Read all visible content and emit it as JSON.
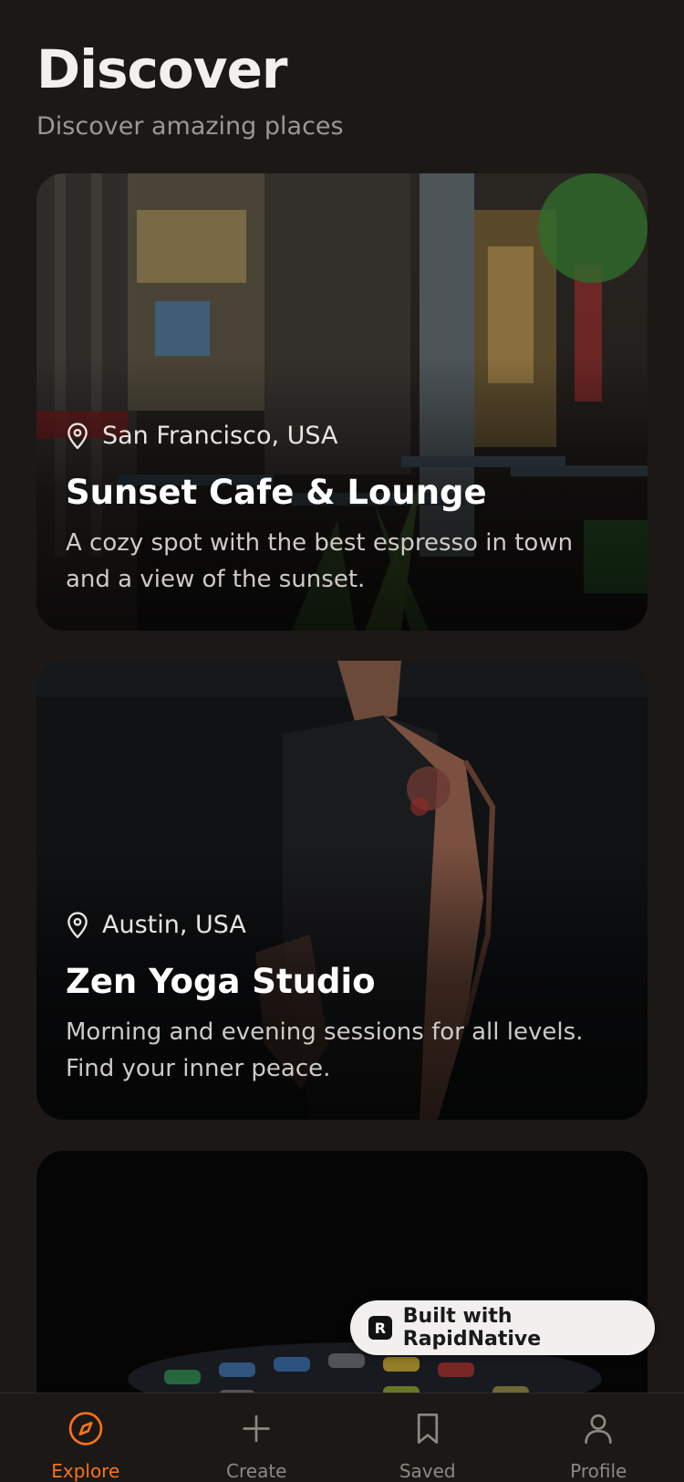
{
  "header": {
    "title": "Discover",
    "subtitle": "Discover amazing places"
  },
  "cards": [
    {
      "location": "San Francisco, USA",
      "name": "Sunset Cafe & Lounge",
      "description": "A cozy spot with the best espresso in town and a view of the sunset."
    },
    {
      "location": "Austin, USA",
      "name": "Zen Yoga Studio",
      "description": "Morning and evening sessions for all levels. Find your inner peace."
    }
  ],
  "badge": {
    "label": "Built with RapidNative",
    "logo_letter": "R"
  },
  "tabbar": {
    "items": [
      {
        "label": "Explore",
        "icon": "compass-icon",
        "active": true
      },
      {
        "label": "Create",
        "icon": "plus-icon",
        "active": false
      },
      {
        "label": "Saved",
        "icon": "bookmark-icon",
        "active": false
      },
      {
        "label": "Profile",
        "icon": "user-icon",
        "active": false
      }
    ]
  },
  "colors": {
    "background": "#1b1816",
    "accent": "#f97316",
    "inactive": "#8d8884"
  }
}
